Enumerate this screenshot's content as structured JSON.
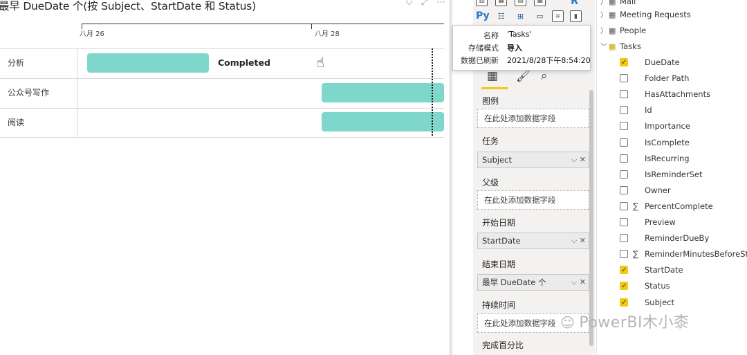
{
  "visual": {
    "title": "最早 DueDate 个(按 Subject、StartDate 和 Status)",
    "header_icons": [
      "filter-icon",
      "focus-mode-icon",
      "more-options-icon"
    ],
    "axis_labels": [
      "八月 26",
      "八月 28"
    ],
    "rows": [
      {
        "label": "分析",
        "status": "Completed"
      },
      {
        "label": "公众号写作",
        "status": ""
      },
      {
        "label": "阅读",
        "status": ""
      }
    ],
    "bar_color": "#7fd7cc"
  },
  "tooltip": {
    "rows": [
      {
        "key": "名称",
        "value": "'Tasks'"
      },
      {
        "key": "存储模式",
        "value": "导入"
      },
      {
        "key": "数据已刷新",
        "value": "2021/8/28下午8:54:20"
      }
    ]
  },
  "viz_pane": {
    "icons": [
      "stacked-bar-chart-icon",
      "table-visual-icon",
      "matrix-icon",
      "map-icon",
      "r-script-icon",
      "python-icon",
      "key-influencers-icon",
      "decomposition-tree-icon",
      "qa-icon",
      "smart-narrative-icon",
      "paginated-report-icon"
    ],
    "tabs": [
      "fields-tab-icon",
      "format-tab-icon",
      "analytics-tab-icon"
    ],
    "python_label": "Py",
    "r_label": "R",
    "wells": [
      {
        "label": "图例",
        "placeholder": "在此处添加数据字段",
        "value": ""
      },
      {
        "label": "任务",
        "placeholder": "",
        "value": "Subject"
      },
      {
        "label": "父级",
        "placeholder": "在此处添加数据字段",
        "value": ""
      },
      {
        "label": "开始日期",
        "placeholder": "",
        "value": "StartDate"
      },
      {
        "label": "结束日期",
        "placeholder": "",
        "value": "最早 DueDate 个"
      },
      {
        "label": "持续时间",
        "placeholder": "在此处添加数据字段",
        "value": ""
      },
      {
        "label": "完成百分比",
        "placeholder": "",
        "value": ""
      }
    ]
  },
  "fields_pane": {
    "tables": [
      {
        "name": "Mail",
        "expanded": false
      },
      {
        "name": "Meeting Requests",
        "expanded": false
      },
      {
        "name": "People",
        "expanded": false
      },
      {
        "name": "Tasks",
        "expanded": true
      }
    ],
    "fields": [
      {
        "name": "DueDate",
        "checked": true,
        "sigma": false
      },
      {
        "name": "Folder Path",
        "checked": false,
        "sigma": false
      },
      {
        "name": "HasAttachments",
        "checked": false,
        "sigma": false
      },
      {
        "name": "Id",
        "checked": false,
        "sigma": false
      },
      {
        "name": "Importance",
        "checked": false,
        "sigma": false
      },
      {
        "name": "IsComplete",
        "checked": false,
        "sigma": false
      },
      {
        "name": "IsRecurring",
        "checked": false,
        "sigma": false
      },
      {
        "name": "IsReminderSet",
        "checked": false,
        "sigma": false
      },
      {
        "name": "Owner",
        "checked": false,
        "sigma": false
      },
      {
        "name": "PercentComplete",
        "checked": false,
        "sigma": true
      },
      {
        "name": "Preview",
        "checked": false,
        "sigma": false
      },
      {
        "name": "ReminderDueBy",
        "checked": false,
        "sigma": false
      },
      {
        "name": "ReminderMinutesBeforeStart",
        "checked": false,
        "sigma": true
      },
      {
        "name": "StartDate",
        "checked": true,
        "sigma": false
      },
      {
        "name": "Status",
        "checked": true,
        "sigma": false
      },
      {
        "name": "Subject",
        "checked": true,
        "sigma": false
      }
    ],
    "sigma_symbol": "∑"
  },
  "watermark": "PowerBI木小桼",
  "colors": {
    "accent": "#f2c811",
    "bar": "#7fd7cc"
  }
}
